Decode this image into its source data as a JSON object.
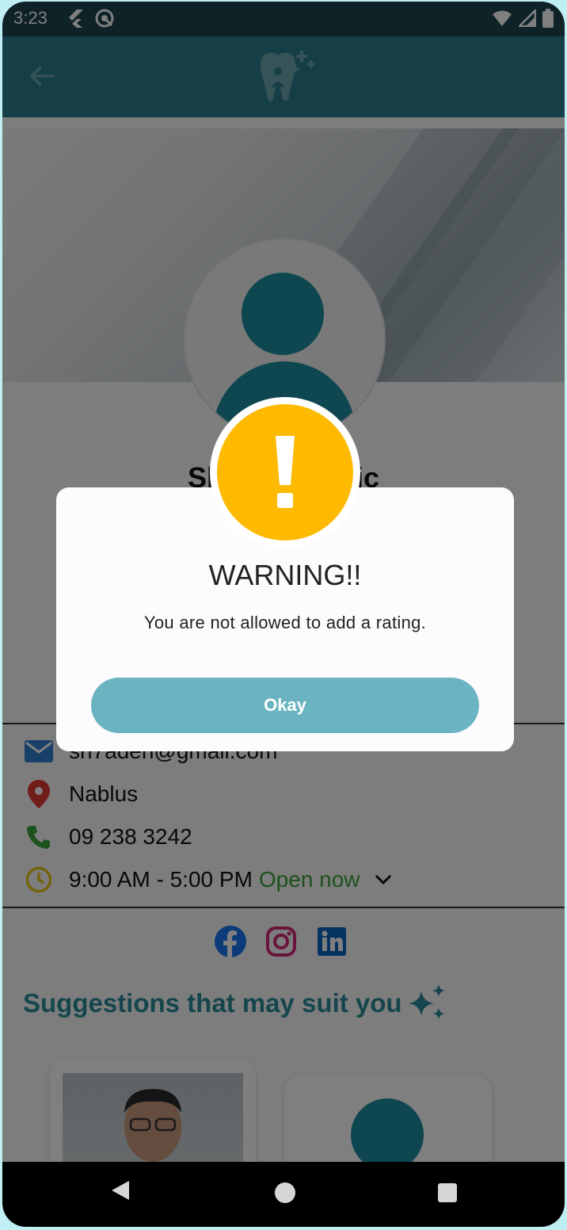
{
  "status_bar": {
    "time": "3:23"
  },
  "clinic": {
    "name": "Sh    nic",
    "email": "sh7aden@gmail.com",
    "city": "Nablus",
    "phone": "09 238 3242",
    "hours": "9:00 AM - 5:00 PM",
    "open_status": "Open now"
  },
  "suggestions": {
    "title": "Suggestions that may suit you"
  },
  "dialog": {
    "title": "WARNING!!",
    "message": "You are not allowed to add a rating.",
    "button_label": "Okay"
  },
  "colors": {
    "appbar": "#2c7d8e",
    "accent": "#2a8d9b",
    "warning": "#fdba00",
    "button": "#6ab3c0",
    "open_now": "#3aa33a"
  },
  "icons": [
    "back-arrow-icon",
    "tooth-logo",
    "mail-icon",
    "location-pin-icon",
    "phone-icon",
    "clock-icon",
    "chevron-down-icon",
    "facebook-icon",
    "instagram-icon",
    "linkedin-icon",
    "sparkles-icon",
    "exclamation-icon"
  ]
}
